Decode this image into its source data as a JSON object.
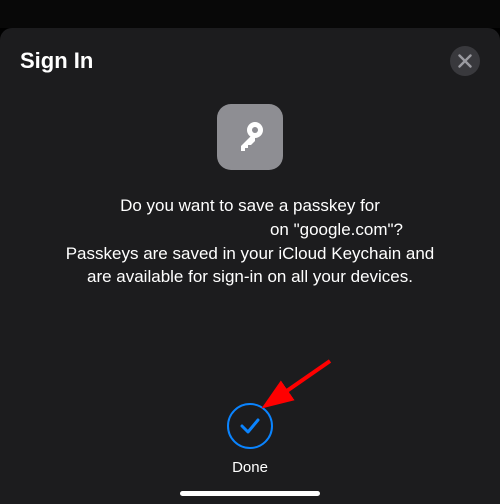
{
  "header": {
    "title": "Sign In",
    "close_icon": "close"
  },
  "icon": {
    "name": "passkey-key-icon"
  },
  "body": {
    "line1": "Do you want to save a passkey for",
    "line2_suffix": " on \"google.com\"?",
    "line3": "Passkeys are saved in your iCloud Keychain and",
    "line4": "are available for sign-in on all your devices."
  },
  "confirm": {
    "done_label": "Done"
  },
  "accent_color": "#0a84ff",
  "annotation": {
    "arrow_color": "#ff0000"
  }
}
